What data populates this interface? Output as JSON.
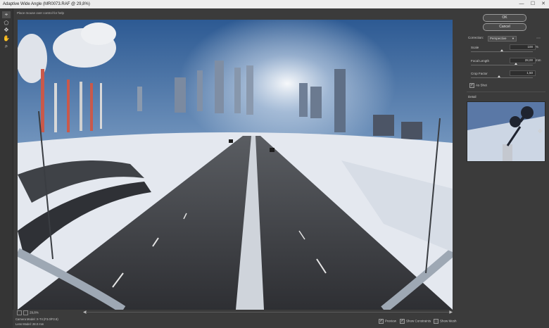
{
  "window": {
    "title": "Adaptive Wide Angle (MR0073.RAF @ 29,8%)",
    "minimize_glyph": "—",
    "maximize_glyph": "☐",
    "close_glyph": "✕"
  },
  "tools": [
    {
      "name": "constraint-tool-icon",
      "glyph": "⌖"
    },
    {
      "name": "polygon-constraint-icon",
      "glyph": "⬠"
    },
    {
      "name": "move-tool-icon",
      "glyph": "✥"
    },
    {
      "name": "hand-tool-icon",
      "glyph": "✋"
    },
    {
      "name": "zoom-tool-icon",
      "glyph": "⌕"
    }
  ],
  "canvas": {
    "hint": "Place mouse over control for help"
  },
  "status": {
    "zoom_value": "29,8%",
    "camera_model": "Camera Model: X-T4 (F3.0/F2.8)",
    "lens_model": "Lens Model: 28.0 mm"
  },
  "options": {
    "preview": {
      "label": "Preview",
      "checked": true
    },
    "show_constraints": {
      "label": "Show Constraints",
      "checked": true
    },
    "show_mesh": {
      "label": "Show Mesh",
      "checked": false
    }
  },
  "panel": {
    "ok_label": "OK",
    "cancel_label": "Cancel",
    "correction_label": "Correction:",
    "correction_value": "Perspective",
    "scale_label": "Scale",
    "scale_value": "100",
    "scale_unit": "%",
    "scale_level": 0.5,
    "focal_label": "Focal Length",
    "focal_value": "28,00",
    "focal_unit": "mm",
    "focal_level": 0.73,
    "crop_label": "Crop Factor",
    "crop_value": "1,50",
    "crop_level": 0.45,
    "as_shot_label": "As Shot",
    "as_shot_checked": true,
    "detail_label": "Detail"
  }
}
